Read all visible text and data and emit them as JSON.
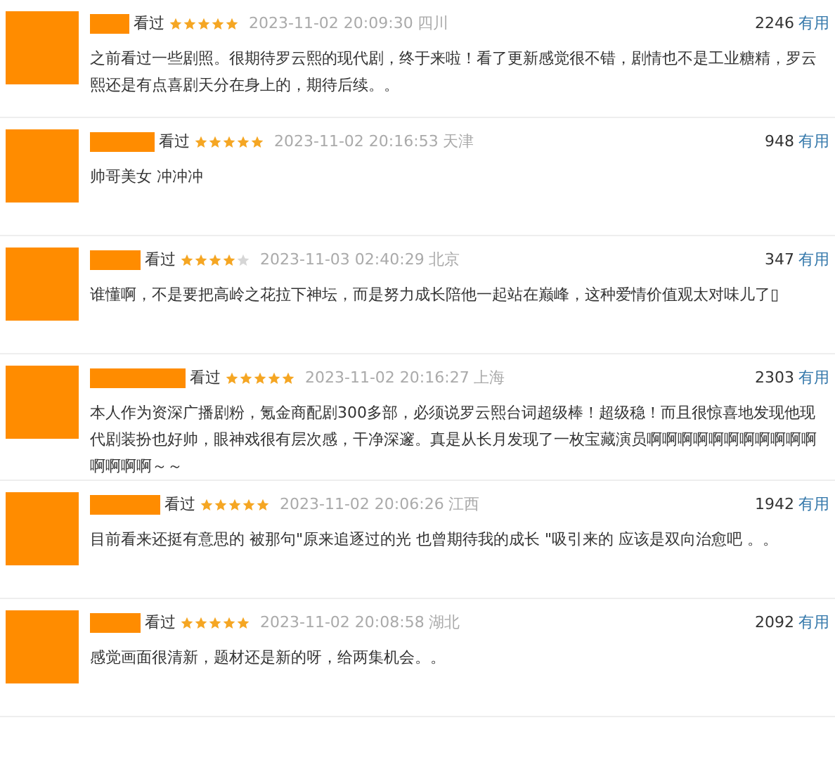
{
  "comments": [
    {
      "status": "看过",
      "stars": 5,
      "time": "2023-11-02 20:09:30",
      "location": "四川",
      "votes": "2246",
      "useful": "有用",
      "text": "之前看过一些剧照。很期待罗云熙的现代剧，终于来啦！看了更新感觉很不错，剧情也不是工业糖精，罗云熙还是有点喜剧天分在身上的，期待后续。。"
    },
    {
      "status": "看过",
      "stars": 5,
      "time": "2023-11-02 20:16:53",
      "location": "天津",
      "votes": "948",
      "useful": "有用",
      "text": "帅哥美女 冲冲冲"
    },
    {
      "status": "看过",
      "stars": 4,
      "time": "2023-11-03 02:40:29",
      "location": "北京",
      "votes": "347",
      "useful": "有用",
      "text": "谁懂啊，不是要把高岭之花拉下神坛，而是努力成长陪他一起站在巅峰，这种爱情价值观太对味儿了▯"
    },
    {
      "status": "看过",
      "stars": 5,
      "time": "2023-11-02 20:16:27",
      "location": "上海",
      "votes": "2303",
      "useful": "有用",
      "text": "本人作为资深广播剧粉，氪金商配剧300多部，必须说罗云熙台词超级棒！超级稳！而且很惊喜地发现他现代剧装扮也好帅，眼神戏很有层次感，干净深邃。真是从长月发现了一枚宝藏演员啊啊啊啊啊啊啊啊啊啊啊啊啊啊啊～～"
    },
    {
      "status": "看过",
      "stars": 5,
      "time": "2023-11-02 20:06:26",
      "location": "江西",
      "votes": "1942",
      "useful": "有用",
      "text": "目前看来还挺有意思的 被那句\"原来追逐过的光 也曾期待我的成长 \"吸引来的 应该是双向治愈吧 。。"
    },
    {
      "status": "看过",
      "stars": 5,
      "time": "2023-11-02 20:08:58",
      "location": "湖北",
      "votes": "2092",
      "useful": "有用",
      "text": "感觉画面很清新，题材还是新的呀，给两集机会。。"
    }
  ]
}
